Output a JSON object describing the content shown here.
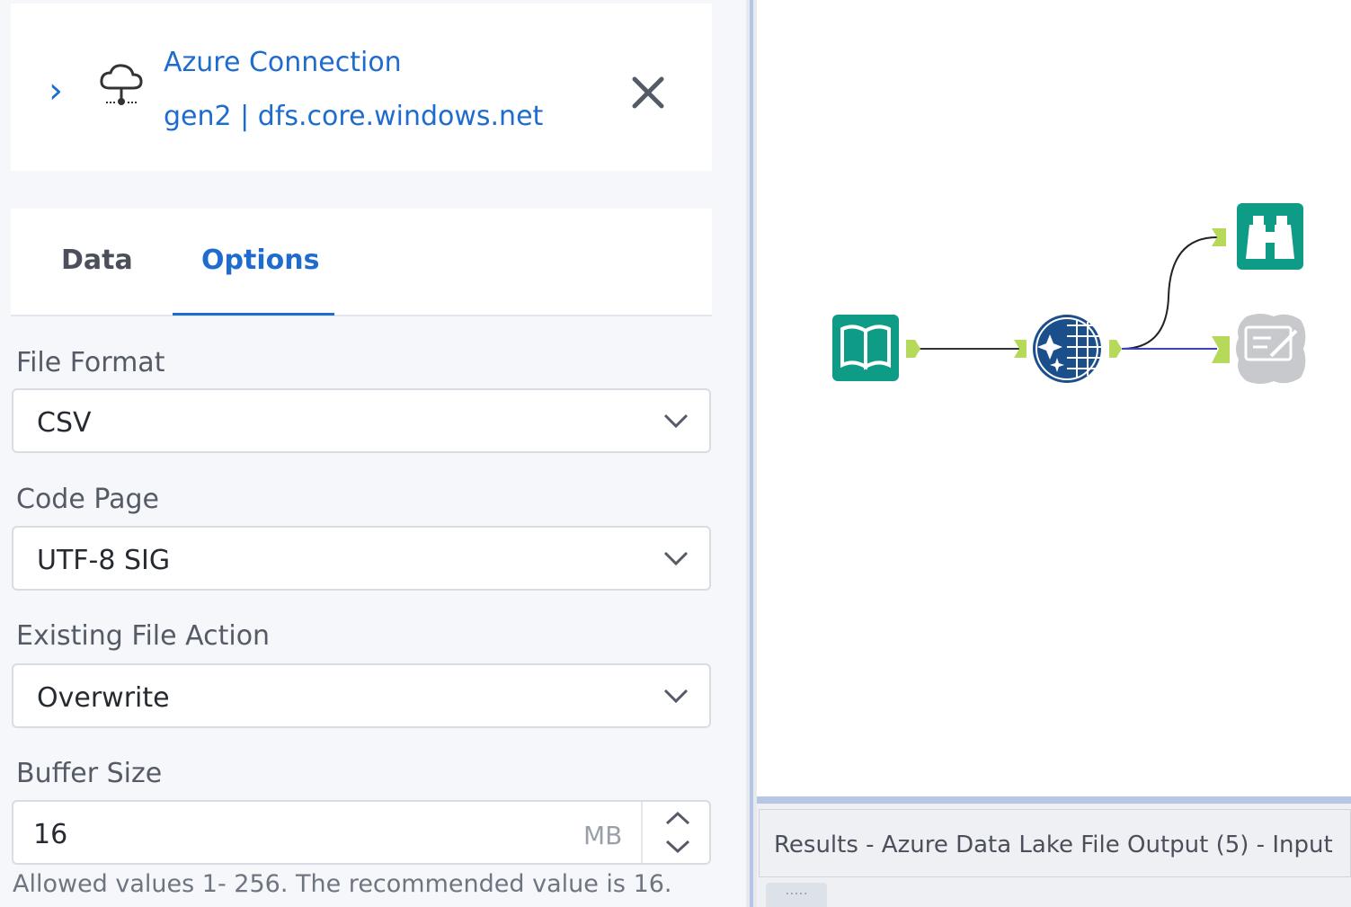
{
  "connection": {
    "title": "Azure Connection",
    "subtitle": "gen2 | dfs.core.windows.net"
  },
  "tabs": [
    {
      "label": "Data",
      "active": false
    },
    {
      "label": "Options",
      "active": true
    }
  ],
  "options": {
    "file_format": {
      "label": "File Format",
      "value": "CSV"
    },
    "code_page": {
      "label": "Code Page",
      "value": "UTF-8 SIG"
    },
    "existing_file_action": {
      "label": "Existing File Action",
      "value": "Overwrite"
    },
    "buffer_size": {
      "label": "Buffer Size",
      "value": "16",
      "unit": "MB",
      "helper": "Allowed values 1- 256. The recommended value is 16."
    }
  },
  "results": {
    "title": "Results - Azure Data Lake File Output (5) - Input",
    "grip": "....."
  },
  "colors": {
    "accent": "#1f6ccf",
    "tool_teal": "#0e9c87",
    "tool_navy": "#1b4f8c",
    "connector_green": "#b6d95a",
    "selected_wire": "#3b3fe0"
  },
  "icons": [
    "chevron-right-icon",
    "cloud-connection-icon",
    "close-icon",
    "chevron-down-icon",
    "chevron-up-icon",
    "book-icon",
    "star-grid-icon",
    "binoculars-icon",
    "file-output-icon"
  ]
}
